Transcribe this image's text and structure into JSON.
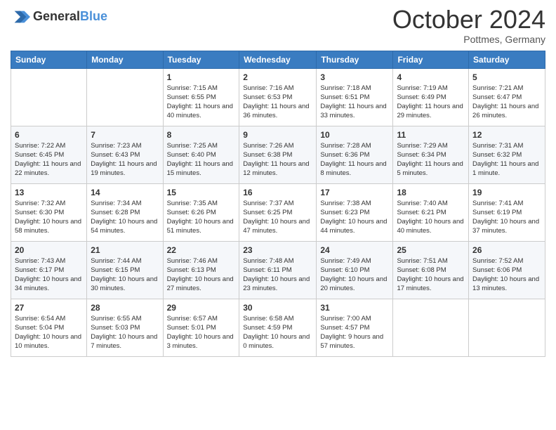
{
  "header": {
    "logo": {
      "general": "General",
      "blue": "Blue"
    },
    "month": "October 2024",
    "location": "Pottmes, Germany"
  },
  "days_of_week": [
    "Sunday",
    "Monday",
    "Tuesday",
    "Wednesday",
    "Thursday",
    "Friday",
    "Saturday"
  ],
  "weeks": [
    [
      {
        "day": "",
        "sunrise": "",
        "sunset": "",
        "daylight": ""
      },
      {
        "day": "",
        "sunrise": "",
        "sunset": "",
        "daylight": ""
      },
      {
        "day": "1",
        "sunrise": "Sunrise: 7:15 AM",
        "sunset": "Sunset: 6:55 PM",
        "daylight": "Daylight: 11 hours and 40 minutes."
      },
      {
        "day": "2",
        "sunrise": "Sunrise: 7:16 AM",
        "sunset": "Sunset: 6:53 PM",
        "daylight": "Daylight: 11 hours and 36 minutes."
      },
      {
        "day": "3",
        "sunrise": "Sunrise: 7:18 AM",
        "sunset": "Sunset: 6:51 PM",
        "daylight": "Daylight: 11 hours and 33 minutes."
      },
      {
        "day": "4",
        "sunrise": "Sunrise: 7:19 AM",
        "sunset": "Sunset: 6:49 PM",
        "daylight": "Daylight: 11 hours and 29 minutes."
      },
      {
        "day": "5",
        "sunrise": "Sunrise: 7:21 AM",
        "sunset": "Sunset: 6:47 PM",
        "daylight": "Daylight: 11 hours and 26 minutes."
      }
    ],
    [
      {
        "day": "6",
        "sunrise": "Sunrise: 7:22 AM",
        "sunset": "Sunset: 6:45 PM",
        "daylight": "Daylight: 11 hours and 22 minutes."
      },
      {
        "day": "7",
        "sunrise": "Sunrise: 7:23 AM",
        "sunset": "Sunset: 6:43 PM",
        "daylight": "Daylight: 11 hours and 19 minutes."
      },
      {
        "day": "8",
        "sunrise": "Sunrise: 7:25 AM",
        "sunset": "Sunset: 6:40 PM",
        "daylight": "Daylight: 11 hours and 15 minutes."
      },
      {
        "day": "9",
        "sunrise": "Sunrise: 7:26 AM",
        "sunset": "Sunset: 6:38 PM",
        "daylight": "Daylight: 11 hours and 12 minutes."
      },
      {
        "day": "10",
        "sunrise": "Sunrise: 7:28 AM",
        "sunset": "Sunset: 6:36 PM",
        "daylight": "Daylight: 11 hours and 8 minutes."
      },
      {
        "day": "11",
        "sunrise": "Sunrise: 7:29 AM",
        "sunset": "Sunset: 6:34 PM",
        "daylight": "Daylight: 11 hours and 5 minutes."
      },
      {
        "day": "12",
        "sunrise": "Sunrise: 7:31 AM",
        "sunset": "Sunset: 6:32 PM",
        "daylight": "Daylight: 11 hours and 1 minute."
      }
    ],
    [
      {
        "day": "13",
        "sunrise": "Sunrise: 7:32 AM",
        "sunset": "Sunset: 6:30 PM",
        "daylight": "Daylight: 10 hours and 58 minutes."
      },
      {
        "day": "14",
        "sunrise": "Sunrise: 7:34 AM",
        "sunset": "Sunset: 6:28 PM",
        "daylight": "Daylight: 10 hours and 54 minutes."
      },
      {
        "day": "15",
        "sunrise": "Sunrise: 7:35 AM",
        "sunset": "Sunset: 6:26 PM",
        "daylight": "Daylight: 10 hours and 51 minutes."
      },
      {
        "day": "16",
        "sunrise": "Sunrise: 7:37 AM",
        "sunset": "Sunset: 6:25 PM",
        "daylight": "Daylight: 10 hours and 47 minutes."
      },
      {
        "day": "17",
        "sunrise": "Sunrise: 7:38 AM",
        "sunset": "Sunset: 6:23 PM",
        "daylight": "Daylight: 10 hours and 44 minutes."
      },
      {
        "day": "18",
        "sunrise": "Sunrise: 7:40 AM",
        "sunset": "Sunset: 6:21 PM",
        "daylight": "Daylight: 10 hours and 40 minutes."
      },
      {
        "day": "19",
        "sunrise": "Sunrise: 7:41 AM",
        "sunset": "Sunset: 6:19 PM",
        "daylight": "Daylight: 10 hours and 37 minutes."
      }
    ],
    [
      {
        "day": "20",
        "sunrise": "Sunrise: 7:43 AM",
        "sunset": "Sunset: 6:17 PM",
        "daylight": "Daylight: 10 hours and 34 minutes."
      },
      {
        "day": "21",
        "sunrise": "Sunrise: 7:44 AM",
        "sunset": "Sunset: 6:15 PM",
        "daylight": "Daylight: 10 hours and 30 minutes."
      },
      {
        "day": "22",
        "sunrise": "Sunrise: 7:46 AM",
        "sunset": "Sunset: 6:13 PM",
        "daylight": "Daylight: 10 hours and 27 minutes."
      },
      {
        "day": "23",
        "sunrise": "Sunrise: 7:48 AM",
        "sunset": "Sunset: 6:11 PM",
        "daylight": "Daylight: 10 hours and 23 minutes."
      },
      {
        "day": "24",
        "sunrise": "Sunrise: 7:49 AM",
        "sunset": "Sunset: 6:10 PM",
        "daylight": "Daylight: 10 hours and 20 minutes."
      },
      {
        "day": "25",
        "sunrise": "Sunrise: 7:51 AM",
        "sunset": "Sunset: 6:08 PM",
        "daylight": "Daylight: 10 hours and 17 minutes."
      },
      {
        "day": "26",
        "sunrise": "Sunrise: 7:52 AM",
        "sunset": "Sunset: 6:06 PM",
        "daylight": "Daylight: 10 hours and 13 minutes."
      }
    ],
    [
      {
        "day": "27",
        "sunrise": "Sunrise: 6:54 AM",
        "sunset": "Sunset: 5:04 PM",
        "daylight": "Daylight: 10 hours and 10 minutes."
      },
      {
        "day": "28",
        "sunrise": "Sunrise: 6:55 AM",
        "sunset": "Sunset: 5:03 PM",
        "daylight": "Daylight: 10 hours and 7 minutes."
      },
      {
        "day": "29",
        "sunrise": "Sunrise: 6:57 AM",
        "sunset": "Sunset: 5:01 PM",
        "daylight": "Daylight: 10 hours and 3 minutes."
      },
      {
        "day": "30",
        "sunrise": "Sunrise: 6:58 AM",
        "sunset": "Sunset: 4:59 PM",
        "daylight": "Daylight: 10 hours and 0 minutes."
      },
      {
        "day": "31",
        "sunrise": "Sunrise: 7:00 AM",
        "sunset": "Sunset: 4:57 PM",
        "daylight": "Daylight: 9 hours and 57 minutes."
      },
      {
        "day": "",
        "sunrise": "",
        "sunset": "",
        "daylight": ""
      },
      {
        "day": "",
        "sunrise": "",
        "sunset": "",
        "daylight": ""
      }
    ]
  ]
}
